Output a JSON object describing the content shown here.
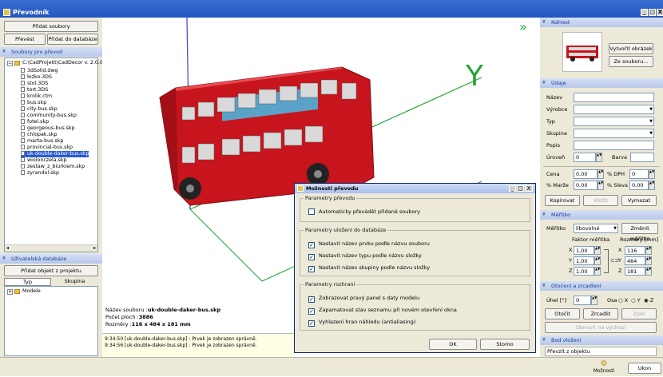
{
  "window": {
    "title": "Převodník",
    "controls": [
      "_",
      "□",
      "X"
    ]
  },
  "left": {
    "top_buttons": {
      "add_files": "Přidat soubory",
      "convert": "Převést",
      "add_to_db": "Přidat do databáze"
    },
    "files_header": "Soubory pro převod",
    "tree_root": "C:\\CadProjekt\\CadDecor v. 2.0.0\\",
    "files": [
      "3dSolid.dwg",
      "łożko.3DS",
      "stol.3DS",
      "tort.3DS",
      "krolik.ctm",
      "bus.skp",
      "city-bus.skp",
      "community-bus.skp",
      "fotel.skp",
      "georgeous-bus.skp",
      "chlopak.skp",
      "marta-bus.skp",
      "provincial-bus.skp",
      "uk-double-daker-bus.skp",
      "wiolonczela.skp",
      "zestaw_z_biurkiem.skp",
      "zyrandol.skp"
    ],
    "selected_file": "uk-double-daker-bus.skp",
    "userdb_header": "Uživatelská databáze",
    "add_object_button": "Přidat objekt z projektu",
    "tabs": [
      "Typ",
      "Skupina"
    ],
    "db_tree_item": "Modele"
  },
  "viewport": {
    "axis_y": "Y",
    "expand_icon": "»",
    "info": {
      "name_label": "Název souboru :",
      "name_value": "uk-double-daker-bus.skp",
      "faces_label": "Počet ploch :",
      "faces_value": "3886",
      "size_label": "Rozměry :",
      "size_value": "116 x 484 x 181 mm"
    },
    "log": [
      "9:34:50 [uk-double-daker-bus.skp] : Prvek je zobrazen správně.",
      "9:34:56 [uk-double-daker-bus.skp] : Prvek je zobrazen správně."
    ]
  },
  "dialog": {
    "title": "Možnosti převodu",
    "groups": [
      {
        "title": "Parametry převodu",
        "options": [
          {
            "label": "Automaticky převádět přidané soubory",
            "checked": false
          }
        ]
      },
      {
        "title": "Parametry uložení do databáze",
        "options": [
          {
            "label": "Nastavit název prvku podle názvu souboru",
            "checked": true
          },
          {
            "label": "Nastavit název typu podle názvu složky",
            "checked": true
          },
          {
            "label": "Nastavit název skupiny podle názvu složky",
            "checked": true
          }
        ]
      },
      {
        "title": "Parametry rozhraní",
        "options": [
          {
            "label": "Zobrazovat pravý panel s daty modelu",
            "checked": true
          },
          {
            "label": "Zapamatovat stav seznamu při novém otevření okna",
            "checked": true
          },
          {
            "label": "Vyhlazení hran náhledu (antialiasing)",
            "checked": true
          }
        ]
      }
    ],
    "ok": "OK",
    "cancel": "Storno"
  },
  "right": {
    "preview_header": "Náhled",
    "create_image": "Vytvořit obrázek",
    "from_file": "Ze souboru...",
    "data_header": "Údaje",
    "fields": {
      "nazev": "Název",
      "vyrobce": "Výrobce",
      "typ": "Typ",
      "skupina": "Skupina",
      "popis": "Popis",
      "uroven": "Úroveň",
      "uroven_value": "0",
      "barva": "Barva",
      "cena": "Cena",
      "cena_value": "0,00",
      "dph": "% DPH",
      "dph_value": "0",
      "marze": "% Marže",
      "marze_value": "0,00",
      "sleva": "% Sleva",
      "sleva_value": "0,00"
    },
    "buttons": {
      "copy": "Kopírovat",
      "paste": "Vložit",
      "clear": "Vymazat"
    },
    "scale_header": "Měřítko",
    "scale_label": "Měřítko",
    "scale_value": "libovolné",
    "change_scale": "Změnit měřítko",
    "factor_label": "Faktor měřítka",
    "dims_label": "Rozměry [mm]",
    "factors": {
      "x": "1,00",
      "y": "1,00",
      "z": "1,00"
    },
    "dims": {
      "x": "116",
      "y": "484",
      "z": "181"
    },
    "rotation_header": "Otočení a zrcadlení",
    "angle_label": "Úhel [°]",
    "angle_value": "0",
    "axis_label": "Osa",
    "axes": [
      "X",
      "Y",
      "Z"
    ],
    "rotate": "Otočit",
    "mirror": "Zrcadlit",
    "back": "Zpět",
    "restore": "Obnovit na výchozí",
    "insert_header": "Bod vložení",
    "insert_value": "Převzít z objektu"
  },
  "footer": {
    "options_label": "Možnosti",
    "close_label": "Ukon"
  },
  "colors": {
    "titlebar": "#2a5bd1",
    "axis_green": "#22a334",
    "bus_red": "#c8141c"
  }
}
